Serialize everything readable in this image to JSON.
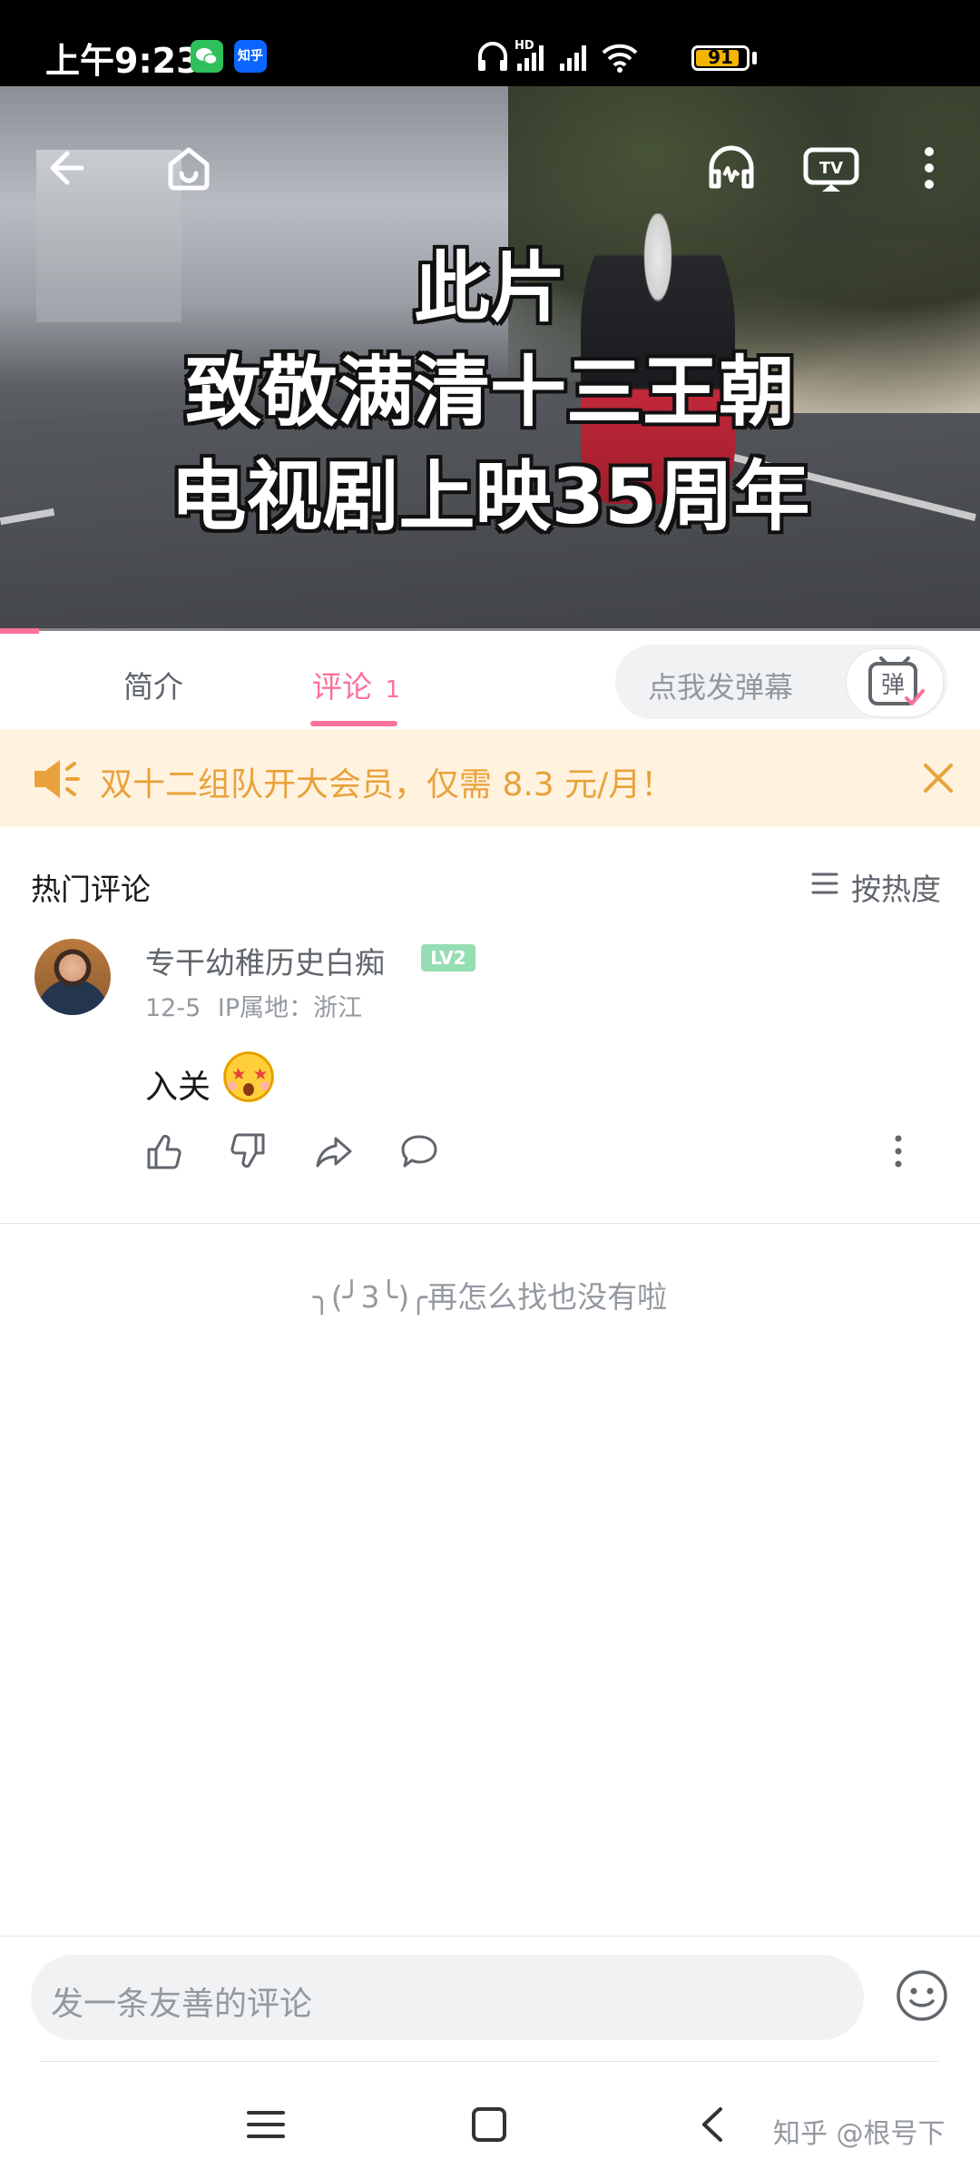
{
  "status_bar": {
    "time": "上午9:23",
    "apps": [
      "wechat-icon",
      "zhihu-icon"
    ],
    "zhihu_label": "知乎",
    "hd_label": "HD",
    "battery_level": "91"
  },
  "video": {
    "overlay_lines": [
      "此片",
      "致敬满清十三王朝",
      "电视剧上映35周年"
    ],
    "icons": [
      "back-arrow-icon",
      "home-icon",
      "headphones-icon",
      "tv-cast-icon",
      "more-vertical-icon"
    ],
    "progress": 0.04
  },
  "tabs": [
    {
      "label": "简介",
      "active": false
    },
    {
      "label": "评论",
      "count": "1",
      "active": true
    }
  ],
  "danmaku": {
    "placeholder": "点我发弹幕",
    "button_label": "弹"
  },
  "banner": {
    "text": "双十二组队开大会员，仅需 8.3 元/月！",
    "accent": "#e9a23b"
  },
  "comments": {
    "title": "热门评论",
    "sort_label": "按热度",
    "items": [
      {
        "username": "专干幼稚历史白痴",
        "level": "LV2",
        "date": "12-5",
        "ip": "IP属地：浙江",
        "text": "入关"
      }
    ],
    "end_text": "╮(╯3╰)╭再怎么找也没有啦"
  },
  "input": {
    "placeholder": "发一条友善的评论"
  },
  "watermark": "知乎 @根号下",
  "colors": {
    "brand_pink": "#fb7299",
    "banner_bg": "#fff3e0",
    "level_green": "#95ddb2"
  }
}
